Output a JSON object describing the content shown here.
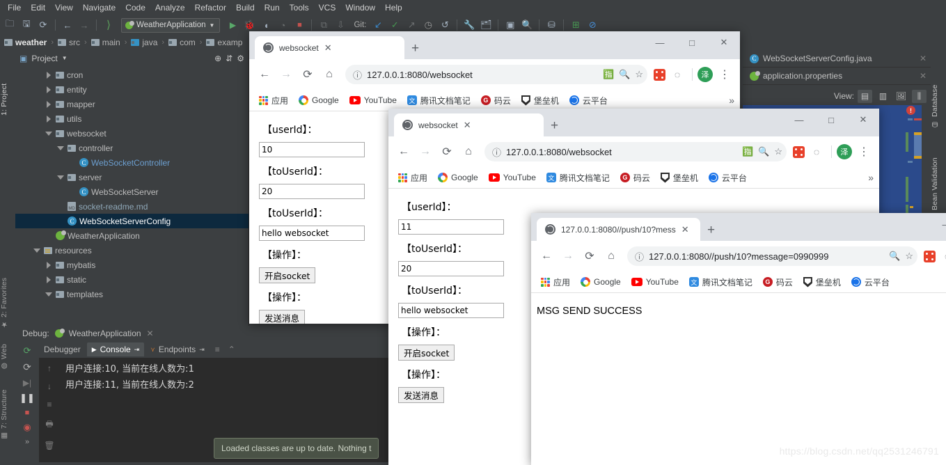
{
  "ide": {
    "menu": [
      "File",
      "Edit",
      "View",
      "Navigate",
      "Code",
      "Analyze",
      "Refactor",
      "Build",
      "Run",
      "Tools",
      "VCS",
      "Window",
      "Help"
    ],
    "toolbar": {
      "run_config": "WeatherApplication",
      "git_label": "Git:"
    },
    "breadcrumb": [
      "weather",
      "src",
      "main",
      "java",
      "com",
      "examp"
    ],
    "project_panel": {
      "title": "Project"
    },
    "tree": [
      {
        "label": "cron",
        "indent": 3,
        "arrow": "right",
        "icon": "folder"
      },
      {
        "label": "entity",
        "indent": 3,
        "arrow": "right",
        "icon": "folder"
      },
      {
        "label": "mapper",
        "indent": 3,
        "arrow": "right",
        "icon": "folder"
      },
      {
        "label": "utils",
        "indent": 3,
        "arrow": "right",
        "icon": "folder"
      },
      {
        "label": "websocket",
        "indent": 3,
        "arrow": "down",
        "icon": "folder"
      },
      {
        "label": "controller",
        "indent": 4,
        "arrow": "down",
        "icon": "folder"
      },
      {
        "label": "WebSocketController",
        "indent": 5,
        "arrow": "none",
        "icon": "class",
        "style": "blue"
      },
      {
        "label": "server",
        "indent": 4,
        "arrow": "down",
        "icon": "folder"
      },
      {
        "label": "WebSocketServer",
        "indent": 5,
        "arrow": "none",
        "icon": "class"
      },
      {
        "label": "socket-readme.md",
        "indent": 4,
        "arrow": "none",
        "icon": "md",
        "style": "md"
      },
      {
        "label": "WebSocketServerConfig",
        "indent": 4,
        "arrow": "none",
        "icon": "class",
        "selected": true
      },
      {
        "label": "WeatherApplication",
        "indent": 3,
        "arrow": "none",
        "icon": "spring"
      },
      {
        "label": "resources",
        "indent": 2,
        "arrow": "down",
        "icon": "resfolder"
      },
      {
        "label": "mybatis",
        "indent": 3,
        "arrow": "right",
        "icon": "folder"
      },
      {
        "label": "static",
        "indent": 3,
        "arrow": "right",
        "icon": "folder"
      },
      {
        "label": "templates",
        "indent": 3,
        "arrow": "down",
        "icon": "folder"
      }
    ],
    "editor_tabs": [
      {
        "label": "WebSocketServerConfig.java",
        "icon": "class"
      },
      {
        "label": "application.properties",
        "icon": "spring"
      }
    ],
    "view_bar": {
      "label": "View:"
    },
    "left_strips": {
      "project": "1: Project",
      "favorites": "2: Favorites",
      "web": "Web",
      "structure": "7: Structure"
    },
    "right_strips": {
      "database": "Database",
      "bean_validation": "Bean Validation"
    },
    "debug": {
      "header_label": "Debug:",
      "header_config": "WeatherApplication",
      "tabs": [
        "Debugger",
        "Console",
        "Endpoints"
      ],
      "active_tab": "Console",
      "console_lines": [
        "用户连接:10, 当前在线人数为:1",
        "用户连接:11, 当前在线人数为:2"
      ]
    },
    "tooltip": "Loaded classes are up to date. Nothing t"
  },
  "browser_common": {
    "bookmarks": [
      {
        "label": "应用",
        "icon": "apps-grid-icon"
      },
      {
        "label": "Google",
        "icon": "google-icon"
      },
      {
        "label": "YouTube",
        "icon": "youtube-icon"
      },
      {
        "label": "腾讯文档笔记",
        "icon": "tencent-docs-icon"
      },
      {
        "label": "码云",
        "icon": "gitee-icon"
      },
      {
        "label": "堡垒机",
        "icon": "shield-icon"
      },
      {
        "label": "云平台",
        "icon": "cloud-platform-icon"
      }
    ],
    "overflow": "»",
    "profile_initial": "泽",
    "new_tab_label": "+",
    "minimize": "—",
    "maximize": "□",
    "close": "✕"
  },
  "window1": {
    "tab_title": "websocket",
    "url": "127.0.0.1:8080/websocket",
    "form": {
      "labels": {
        "user": "【userId】：",
        "touser": "【toUserId】：",
        "action": "【操作】："
      },
      "user_id": "10",
      "to_user_id": "20",
      "message": "hello websocket",
      "open_socket_button": "开启socket",
      "send_message_button": "发送消息"
    }
  },
  "window2": {
    "tab_title": "websocket",
    "url": "127.0.0.1:8080/websocket",
    "form": {
      "labels": {
        "user": "【userId】：",
        "touser": "【toUserId】：",
        "action": "【操作】："
      },
      "user_id": "11",
      "to_user_id": "20",
      "message": "hello websocket",
      "open_socket_button": "开启socket",
      "send_message_button": "发送消息"
    }
  },
  "window3": {
    "tab_title": "127.0.0.1:8080//push/10?mess",
    "url": "127.0.0.1:8080//push/10?message=0990999",
    "body_text": "MSG SEND SUCCESS"
  },
  "watermark": "https://blog.csdn.net/qq2531246791",
  "colors": {
    "ide_bg": "#3c3f41",
    "console_bg": "#2b2b2b",
    "tree_selection": "#0d293e",
    "editor_selection": "#2b4a8b",
    "chrome_tabstrip": "#dee1e6",
    "accent_green": "#2e9e57",
    "error_red": "#d1433b"
  }
}
